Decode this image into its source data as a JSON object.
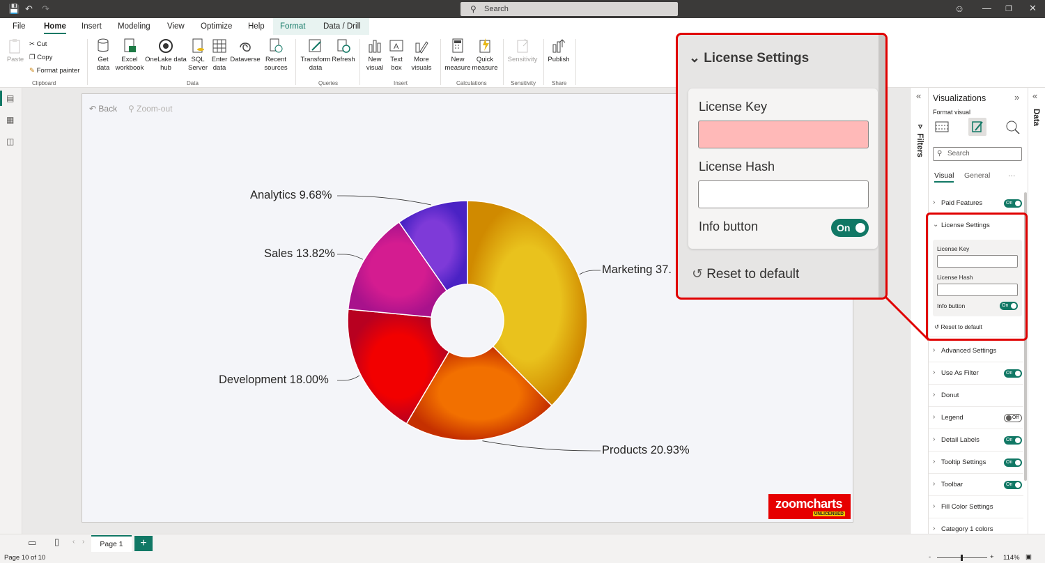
{
  "titlebar": {
    "search_placeholder": "Search"
  },
  "ribbon_tabs": [
    "File",
    "Home",
    "Insert",
    "Modeling",
    "View",
    "Optimize",
    "Help",
    "Format",
    "Data / Drill"
  ],
  "clipboard": {
    "paste": "Paste",
    "cut": "Cut",
    "copy": "Copy",
    "format_painter": "Format painter",
    "group": "Clipboard"
  },
  "data_group": {
    "get_data": "Get data",
    "excel": "Excel workbook",
    "onelake": "OneLake data hub",
    "sql": "SQL Server",
    "enter": "Enter data",
    "dataverse": "Dataverse",
    "recent": "Recent sources",
    "group": "Data"
  },
  "queries_group": {
    "transform": "Transform data",
    "refresh": "Refresh",
    "group": "Queries"
  },
  "insert_group": {
    "new_visual": "New visual",
    "text_box": "Text box",
    "more_visuals": "More visuals",
    "group": "Insert"
  },
  "calc_group": {
    "new_measure": "New measure",
    "quick_measure": "Quick measure",
    "group": "Calculations"
  },
  "sensitivity_group": {
    "sensitivity": "Sensitivity",
    "group": "Sensitivity"
  },
  "share_group": {
    "publish": "Publish",
    "group": "Share"
  },
  "visual_toolbar": {
    "back": "Back",
    "zoom_out": "Zoom-out"
  },
  "chart_data": {
    "type": "pie",
    "style": "donut",
    "categories": [
      "Marketing",
      "Products",
      "Development",
      "Sales",
      "Analytics"
    ],
    "values": [
      37.57,
      20.93,
      18.0,
      13.82,
      9.68
    ],
    "labels": [
      "Marketing 37.",
      "Products 20.93%",
      "Development 18.00%",
      "Sales 13.82%",
      "Analytics 9.68%"
    ],
    "colors": [
      "#e8b817",
      "#ef6a0a",
      "#e30a0a",
      "#c81a8c",
      "#7b3fd8"
    ]
  },
  "logo": {
    "brand": "zoomcharts",
    "badge": "UNLICENSED"
  },
  "filters_label": "Filters",
  "data_label": "Data",
  "viz_pane": {
    "title": "Visualizations",
    "subtitle": "Format visual",
    "search_placeholder": "Search",
    "tabs": [
      "Visual",
      "General"
    ],
    "more": "···",
    "rows": [
      {
        "label": "Paid Features",
        "toggle": "On"
      },
      {
        "label": "Advanced Settings",
        "toggle": ""
      },
      {
        "label": "Use As Filter",
        "toggle": "On"
      },
      {
        "label": "Donut",
        "toggle": ""
      },
      {
        "label": "Legend",
        "toggle": "Off"
      },
      {
        "label": "Detail Labels",
        "toggle": "On"
      },
      {
        "label": "Tooltip Settings",
        "toggle": "On"
      },
      {
        "label": "Toolbar",
        "toggle": "On"
      },
      {
        "label": "Fill Color Settings",
        "toggle": ""
      },
      {
        "label": "Category 1 colors",
        "toggle": ""
      }
    ],
    "license": {
      "header": "License Settings",
      "key_label": "License Key",
      "hash_label": "License Hash",
      "info_label": "Info button",
      "info_toggle": "On",
      "reset": "Reset to default"
    }
  },
  "callout": {
    "header": "License Settings",
    "key_label": "License Key",
    "hash_label": "License Hash",
    "info_label": "Info button",
    "info_toggle": "On",
    "reset": "Reset to default"
  },
  "pages": {
    "tab": "Page 1",
    "add": "+"
  },
  "status": {
    "page_info": "Page 10 of 10",
    "zoom": "114%"
  }
}
